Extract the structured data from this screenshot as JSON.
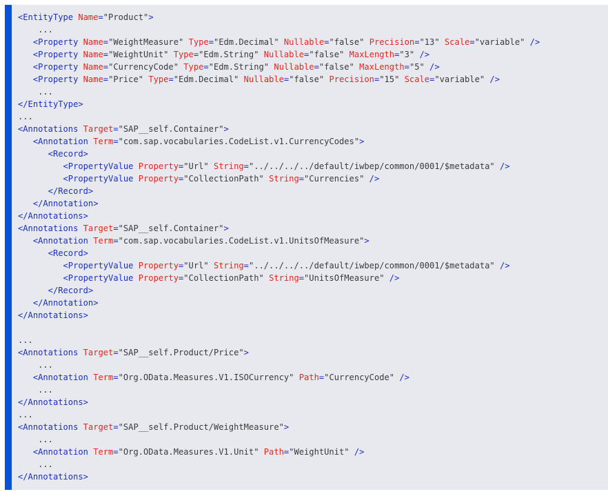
{
  "code_lines": [
    [
      [
        "tag",
        "<EntityType "
      ],
      [
        "attr",
        "Name"
      ],
      [
        "tag",
        "="
      ],
      [
        "val",
        "\"Product\""
      ],
      [
        "tag",
        ">"
      ]
    ],
    [
      [
        "txt",
        "    ..."
      ]
    ],
    [
      [
        "tag",
        "   <Property "
      ],
      [
        "attr",
        "Name"
      ],
      [
        "tag",
        "="
      ],
      [
        "val",
        "\"WeightMeasure\""
      ],
      [
        "tag",
        " "
      ],
      [
        "attr",
        "Type"
      ],
      [
        "tag",
        "="
      ],
      [
        "val",
        "\"Edm.Decimal\""
      ],
      [
        "tag",
        " "
      ],
      [
        "attr",
        "Nullable"
      ],
      [
        "tag",
        "="
      ],
      [
        "val",
        "\"false\""
      ],
      [
        "tag",
        " "
      ],
      [
        "attr",
        "Precision"
      ],
      [
        "tag",
        "="
      ],
      [
        "val",
        "\"13\""
      ],
      [
        "tag",
        " "
      ],
      [
        "attr",
        "Scale"
      ],
      [
        "tag",
        "="
      ],
      [
        "val",
        "\"variable\""
      ],
      [
        "tag",
        " />"
      ]
    ],
    [
      [
        "tag",
        "   <Property "
      ],
      [
        "attr",
        "Name"
      ],
      [
        "tag",
        "="
      ],
      [
        "val",
        "\"WeightUnit\""
      ],
      [
        "tag",
        " "
      ],
      [
        "attr",
        "Type"
      ],
      [
        "tag",
        "="
      ],
      [
        "val",
        "\"Edm.String\""
      ],
      [
        "tag",
        " "
      ],
      [
        "attr",
        "Nullable"
      ],
      [
        "tag",
        "="
      ],
      [
        "val",
        "\"false\""
      ],
      [
        "tag",
        " "
      ],
      [
        "attr",
        "MaxLength"
      ],
      [
        "tag",
        "="
      ],
      [
        "val",
        "\"3\""
      ],
      [
        "tag",
        " />"
      ]
    ],
    [
      [
        "tag",
        "   <Property "
      ],
      [
        "attr",
        "Name"
      ],
      [
        "tag",
        "="
      ],
      [
        "val",
        "\"CurrencyCode\""
      ],
      [
        "tag",
        " "
      ],
      [
        "attr",
        "Type"
      ],
      [
        "tag",
        "="
      ],
      [
        "val",
        "\"Edm.String\""
      ],
      [
        "tag",
        " "
      ],
      [
        "attr",
        "Nullable"
      ],
      [
        "tag",
        "="
      ],
      [
        "val",
        "\"false\""
      ],
      [
        "tag",
        " "
      ],
      [
        "attr",
        "MaxLength"
      ],
      [
        "tag",
        "="
      ],
      [
        "val",
        "\"5\""
      ],
      [
        "tag",
        " />"
      ]
    ],
    [
      [
        "tag",
        "   <Property "
      ],
      [
        "attr",
        "Name"
      ],
      [
        "tag",
        "="
      ],
      [
        "val",
        "\"Price\""
      ],
      [
        "tag",
        " "
      ],
      [
        "attr",
        "Type"
      ],
      [
        "tag",
        "="
      ],
      [
        "val",
        "\"Edm.Decimal\""
      ],
      [
        "tag",
        " "
      ],
      [
        "attr",
        "Nullable"
      ],
      [
        "tag",
        "="
      ],
      [
        "val",
        "\"false\""
      ],
      [
        "tag",
        " "
      ],
      [
        "attr",
        "Precision"
      ],
      [
        "tag",
        "="
      ],
      [
        "val",
        "\"15\""
      ],
      [
        "tag",
        " "
      ],
      [
        "attr",
        "Scale"
      ],
      [
        "tag",
        "="
      ],
      [
        "val",
        "\"variable\""
      ],
      [
        "tag",
        " />"
      ]
    ],
    [
      [
        "txt",
        "    ..."
      ]
    ],
    [
      [
        "tag",
        "</EntityType>"
      ]
    ],
    [
      [
        "txt",
        "..."
      ]
    ],
    [
      [
        "tag",
        "<Annotations "
      ],
      [
        "attr",
        "Target"
      ],
      [
        "tag",
        "="
      ],
      [
        "val",
        "\"SAP__self.Container\""
      ],
      [
        "tag",
        ">"
      ]
    ],
    [
      [
        "tag",
        "   <Annotation "
      ],
      [
        "attr",
        "Term"
      ],
      [
        "tag",
        "="
      ],
      [
        "val",
        "\"com.sap.vocabularies.CodeList.v1.CurrencyCodes\""
      ],
      [
        "tag",
        ">"
      ]
    ],
    [
      [
        "tag",
        "      <Record>"
      ]
    ],
    [
      [
        "tag",
        "         <PropertyValue "
      ],
      [
        "attr",
        "Property"
      ],
      [
        "tag",
        "="
      ],
      [
        "val",
        "\"Url\""
      ],
      [
        "tag",
        " "
      ],
      [
        "attr",
        "String"
      ],
      [
        "tag",
        "="
      ],
      [
        "val",
        "\"../../../../default/iwbep/common/0001/$metadata\""
      ],
      [
        "tag",
        " />"
      ]
    ],
    [
      [
        "tag",
        "         <PropertyValue "
      ],
      [
        "attr",
        "Property"
      ],
      [
        "tag",
        "="
      ],
      [
        "val",
        "\"CollectionPath\""
      ],
      [
        "tag",
        " "
      ],
      [
        "attr",
        "String"
      ],
      [
        "tag",
        "="
      ],
      [
        "val",
        "\"Currencies\""
      ],
      [
        "tag",
        " />"
      ]
    ],
    [
      [
        "tag",
        "      </Record>"
      ]
    ],
    [
      [
        "tag",
        "   </Annotation>"
      ]
    ],
    [
      [
        "tag",
        "</Annotations>"
      ]
    ],
    [
      [
        "tag",
        "<Annotations "
      ],
      [
        "attr",
        "Target"
      ],
      [
        "tag",
        "="
      ],
      [
        "val",
        "\"SAP__self.Container\""
      ],
      [
        "tag",
        ">"
      ]
    ],
    [
      [
        "tag",
        "   <Annotation "
      ],
      [
        "attr",
        "Term"
      ],
      [
        "tag",
        "="
      ],
      [
        "val",
        "\"com.sap.vocabularies.CodeList.v1.UnitsOfMeasure\""
      ],
      [
        "tag",
        ">"
      ]
    ],
    [
      [
        "tag",
        "      <Record>"
      ]
    ],
    [
      [
        "tag",
        "         <PropertyValue "
      ],
      [
        "attr",
        "Property"
      ],
      [
        "tag",
        "="
      ],
      [
        "val",
        "\"Url\""
      ],
      [
        "tag",
        " "
      ],
      [
        "attr",
        "String"
      ],
      [
        "tag",
        "="
      ],
      [
        "val",
        "\"../../../../default/iwbep/common/0001/$metadata\""
      ],
      [
        "tag",
        " />"
      ]
    ],
    [
      [
        "tag",
        "         <PropertyValue "
      ],
      [
        "attr",
        "Property"
      ],
      [
        "tag",
        "="
      ],
      [
        "val",
        "\"CollectionPath\""
      ],
      [
        "tag",
        " "
      ],
      [
        "attr",
        "String"
      ],
      [
        "tag",
        "="
      ],
      [
        "val",
        "\"UnitsOfMeasure\""
      ],
      [
        "tag",
        " />"
      ]
    ],
    [
      [
        "tag",
        "      </Record>"
      ]
    ],
    [
      [
        "tag",
        "   </Annotation>"
      ]
    ],
    [
      [
        "tag",
        "</Annotations>"
      ]
    ],
    [],
    [
      [
        "txt",
        "..."
      ]
    ],
    [
      [
        "tag",
        "<Annotations "
      ],
      [
        "attr",
        "Target"
      ],
      [
        "tag",
        "="
      ],
      [
        "val",
        "\"SAP__self.Product/Price\""
      ],
      [
        "tag",
        ">"
      ]
    ],
    [
      [
        "txt",
        "    ..."
      ]
    ],
    [
      [
        "tag",
        "   <Annotation "
      ],
      [
        "attr",
        "Term"
      ],
      [
        "tag",
        "="
      ],
      [
        "val",
        "\"Org.OData.Measures.V1.ISOCurrency\""
      ],
      [
        "tag",
        " "
      ],
      [
        "attr",
        "Path"
      ],
      [
        "tag",
        "="
      ],
      [
        "val",
        "\"CurrencyCode\""
      ],
      [
        "tag",
        " />"
      ]
    ],
    [
      [
        "txt",
        "    ..."
      ]
    ],
    [
      [
        "tag",
        "</Annotations>"
      ]
    ],
    [
      [
        "txt",
        "..."
      ]
    ],
    [
      [
        "tag",
        "<Annotations "
      ],
      [
        "attr",
        "Target"
      ],
      [
        "tag",
        "="
      ],
      [
        "val",
        "\"SAP__self.Product/WeightMeasure\""
      ],
      [
        "tag",
        ">"
      ]
    ],
    [
      [
        "txt",
        "    ..."
      ]
    ],
    [
      [
        "tag",
        "   <Annotation "
      ],
      [
        "attr",
        "Term"
      ],
      [
        "tag",
        "="
      ],
      [
        "val",
        "\"Org.OData.Measures.V1.Unit\""
      ],
      [
        "tag",
        " "
      ],
      [
        "attr",
        "Path"
      ],
      [
        "tag",
        "="
      ],
      [
        "val",
        "\"WeightUnit\""
      ],
      [
        "tag",
        " />"
      ]
    ],
    [
      [
        "txt",
        "    ..."
      ]
    ],
    [
      [
        "tag",
        "</Annotations>"
      ]
    ]
  ],
  "colors": {
    "tag": "#1a2fc2",
    "attribute": "#e8261e",
    "value": "#3a3a3a",
    "accent_bar": "#0a52d4",
    "background": "#e8e9ee"
  }
}
